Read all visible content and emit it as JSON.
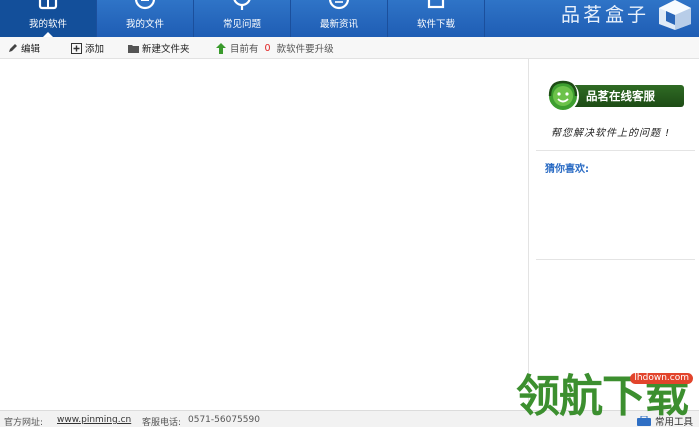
{
  "tabs": [
    {
      "label": "我的软件",
      "icon": "software-box-icon",
      "active": true
    },
    {
      "label": "我的文件",
      "icon": "file-circle-icon",
      "active": false
    },
    {
      "label": "常见问题",
      "icon": "question-pin-icon",
      "active": false
    },
    {
      "label": "最新资讯",
      "icon": "news-circle-icon",
      "active": false
    },
    {
      "label": "软件下载",
      "icon": "download-box-icon",
      "active": false
    }
  ],
  "brand": {
    "name": "品茗盒子",
    "logo_icon": "cube-logo-icon"
  },
  "toolbar": {
    "edit_label": "编辑",
    "add_label": "添加",
    "new_folder_label": "新建文件夹",
    "upgrade_prefix": "目前有",
    "upgrade_count": "0",
    "upgrade_suffix": "款软件要升级"
  },
  "side": {
    "service_label": "品茗在线客服",
    "slogan": "帮您解决软件上的问题 !",
    "guess_label": "猜你喜欢:"
  },
  "status": {
    "website_label": "官方网址:",
    "website": "www.pinming.cn",
    "phone_label": "客服电话:",
    "phone": "0571-56075590",
    "tools_label": "常用工具"
  },
  "watermark": {
    "text": "领航下载",
    "domain": "lhdown.com"
  },
  "colors": {
    "topbar": "#2364b8",
    "active_tab": "#134f9a",
    "service": "#2f6b24",
    "count": "#e02020",
    "guess": "#2b6cc4"
  }
}
